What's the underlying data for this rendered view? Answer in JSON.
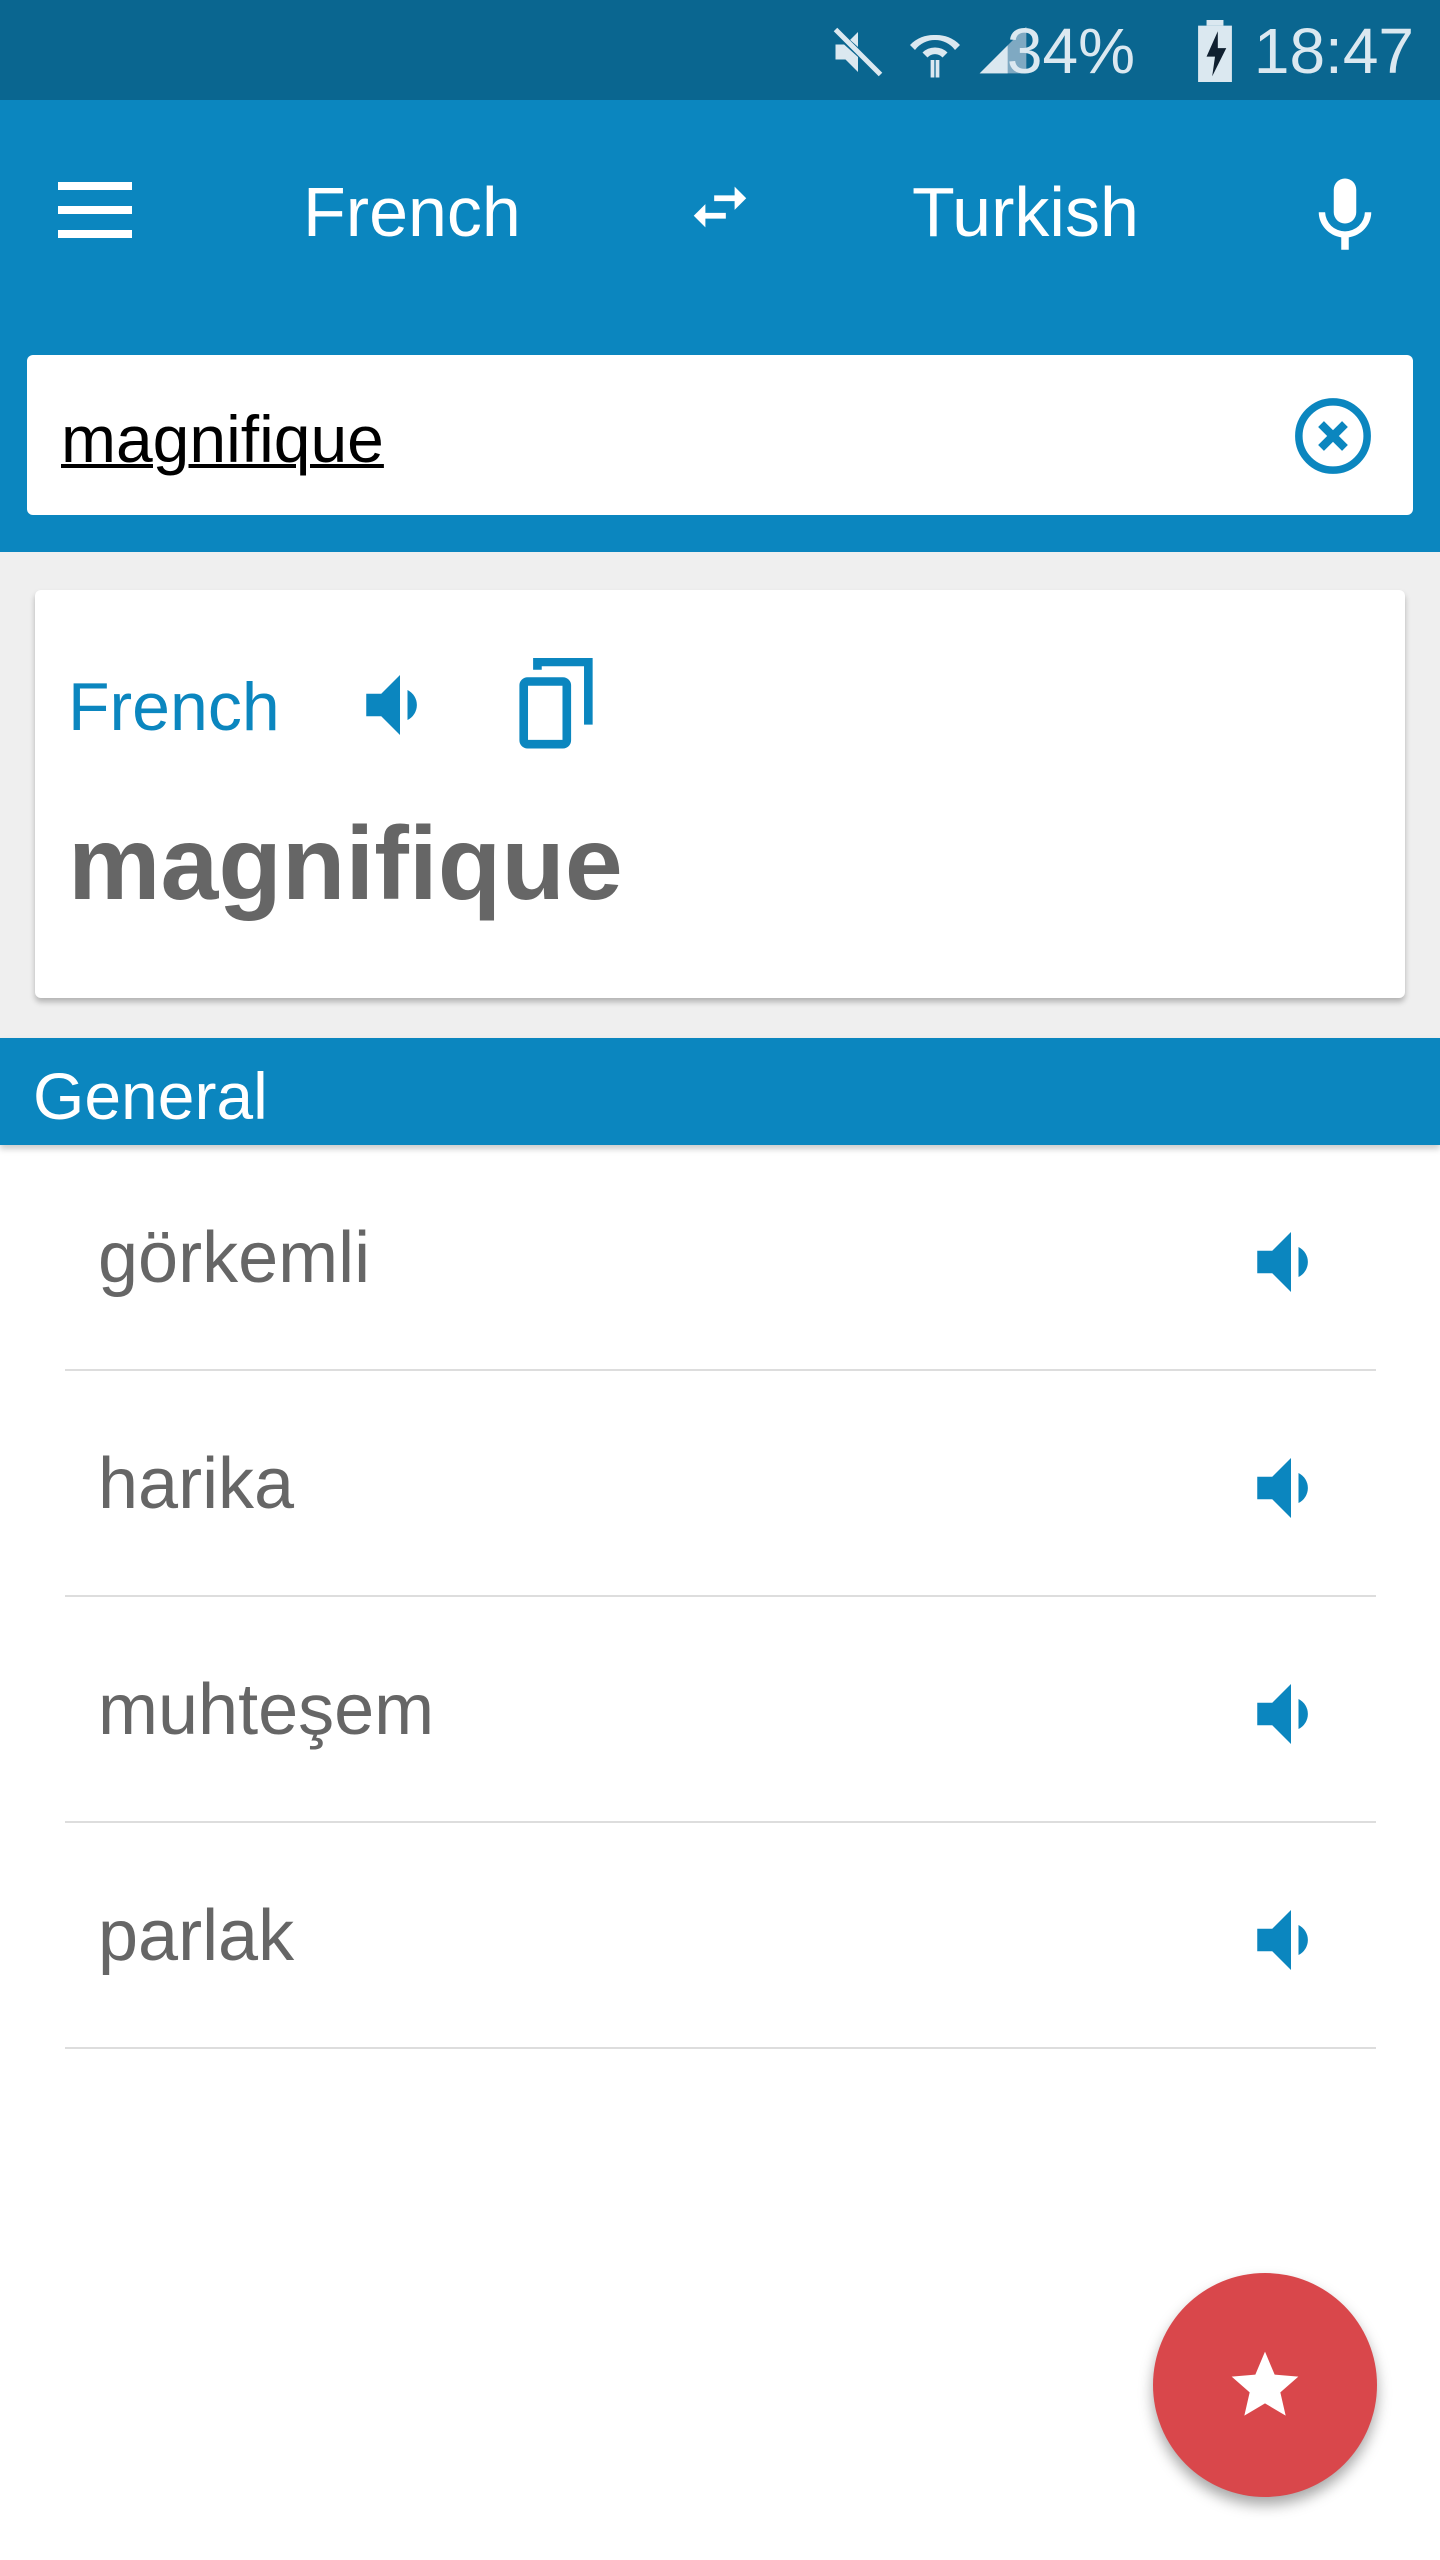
{
  "status_bar": {
    "battery": "34%",
    "time": "18:47"
  },
  "toolbar": {
    "source_language": "French",
    "target_language": "Turkish"
  },
  "search": {
    "value": "magnifique"
  },
  "card": {
    "language": "French",
    "word": "magnifique"
  },
  "section": {
    "title": "General"
  },
  "translations": [
    "görkemli",
    "harika",
    "muhteşem",
    "parlak"
  ],
  "colors": {
    "primary": "#0b86bf",
    "status_bar": "#0a6690",
    "fab": "#d9474b"
  }
}
